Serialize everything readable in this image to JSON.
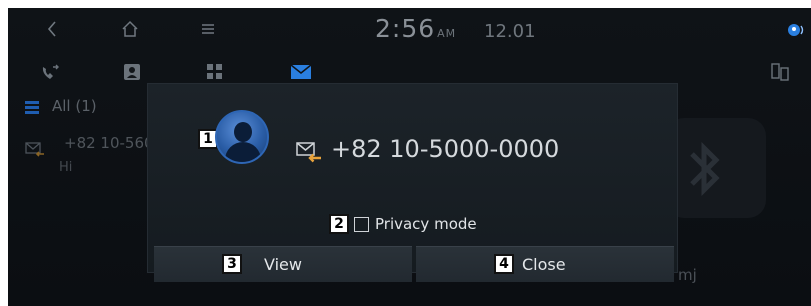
{
  "status_bar": {
    "time": "2:56",
    "ampm": "AM",
    "date": "12.01"
  },
  "list": {
    "all_label": "All (1)",
    "item_number": "+82 10-560",
    "item_preview": "Hi"
  },
  "background_partial_text": "mj",
  "popup": {
    "phone_number": "+82 10-5000-0000",
    "privacy_label": "Privacy mode",
    "privacy_checked": false,
    "view_label": "View",
    "close_label": "Close"
  },
  "callouts": [
    "1",
    "2",
    "3",
    "4"
  ],
  "icons": {
    "back": "back-chevron-icon",
    "home": "home-icon",
    "menu": "menu-lines-icon",
    "call_log": "call-log-icon",
    "contacts": "contacts-icon",
    "dialpad": "dialpad-icon",
    "messages": "messages-icon",
    "switch": "switch-device-icon",
    "assistant": "voice-assistant-icon",
    "list": "list-icon",
    "bluetooth": "bluetooth-icon"
  },
  "colors": {
    "accent_blue": "#3a8be6",
    "accent_orange": "#e8a33c",
    "popup_bg": "#1a2026"
  }
}
